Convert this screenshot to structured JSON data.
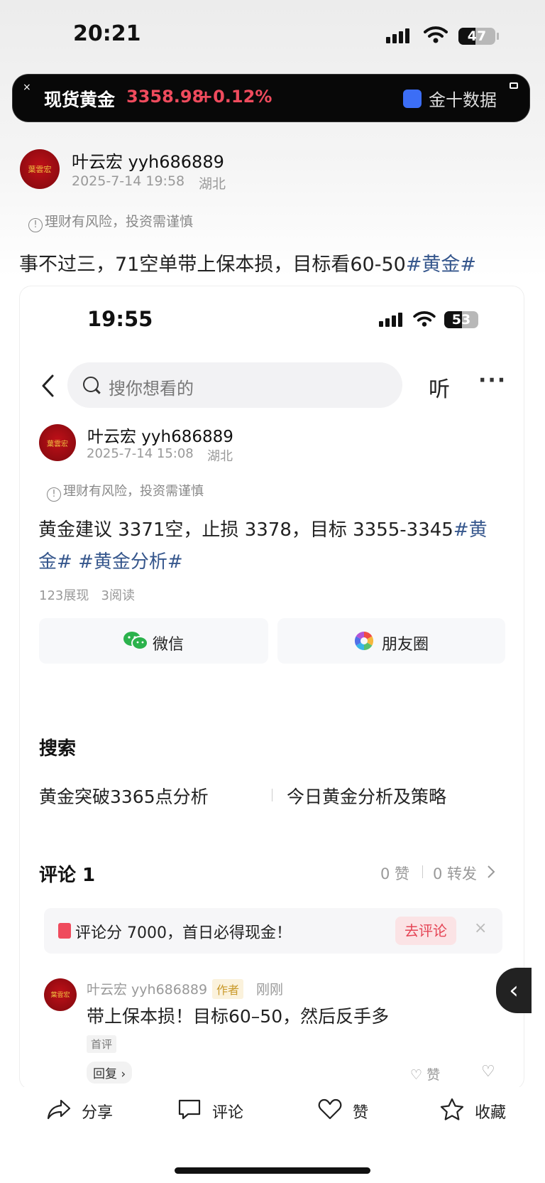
{
  "status_bar": {
    "time": "20:21",
    "battery": "47",
    "battery_fraction": 0.47
  },
  "ticker": {
    "close": "×",
    "name": "现货黄金",
    "price": "3358.98",
    "change": "+0.12%",
    "source": "金十数据",
    "colors": {
      "up": "#ef4b5d",
      "bg": "#080808"
    }
  },
  "post": {
    "avatar_text": "葉雲宏",
    "username": "叶云宏 yyh686889",
    "timestamp": "2025-7-14 19:58",
    "location": "湖北",
    "risk_notice": "理财有风险，投资需谨慎",
    "text": "事不过三，71空单带上保本损，目标看60-50",
    "tag": "#黄金#"
  },
  "screenshot": {
    "status_time": "19:55",
    "battery": "53",
    "battery_fraction": 0.53,
    "search_placeholder": "搜你想看的",
    "listen_label": "听",
    "more_label": "···",
    "post": {
      "avatar_text": "葉雲宏",
      "username": "叶云宏 yyh686889",
      "timestamp": "2025-7-14 15:08",
      "location": "湖北",
      "risk_notice": "理财有风险，投资需谨慎",
      "text_line1": "黄金建议 3371空，止损 3378，目标 3355-3345",
      "tag_a": "#黄",
      "tag_b": "金#",
      "tag_c": "#黄金分析#",
      "stats": "123展现   3阅读"
    },
    "share": {
      "wechat": "微信",
      "moments": "朋友圈"
    },
    "search_section": {
      "title": "搜索",
      "items": [
        "黄金突破3365点分析",
        "今日黄金分析及策略"
      ]
    },
    "comments": {
      "title": "评论 1",
      "likes": "0 赞",
      "reposts": "0 转发",
      "banner_text": "评论分 7000，首日必得现金！",
      "banner_button": "去评论",
      "banner_close": "×",
      "item": {
        "username": "叶云宏 yyh686889",
        "author_badge": "作者",
        "time": "刚刚",
        "text": "带上保本损！目标60–50，然后反手多",
        "first_badge": "首评",
        "reply": "回复",
        "like": "赞"
      }
    }
  },
  "bottom_bar": {
    "share": "分享",
    "comment": "评论",
    "like": "赞",
    "favorite": "收藏"
  }
}
